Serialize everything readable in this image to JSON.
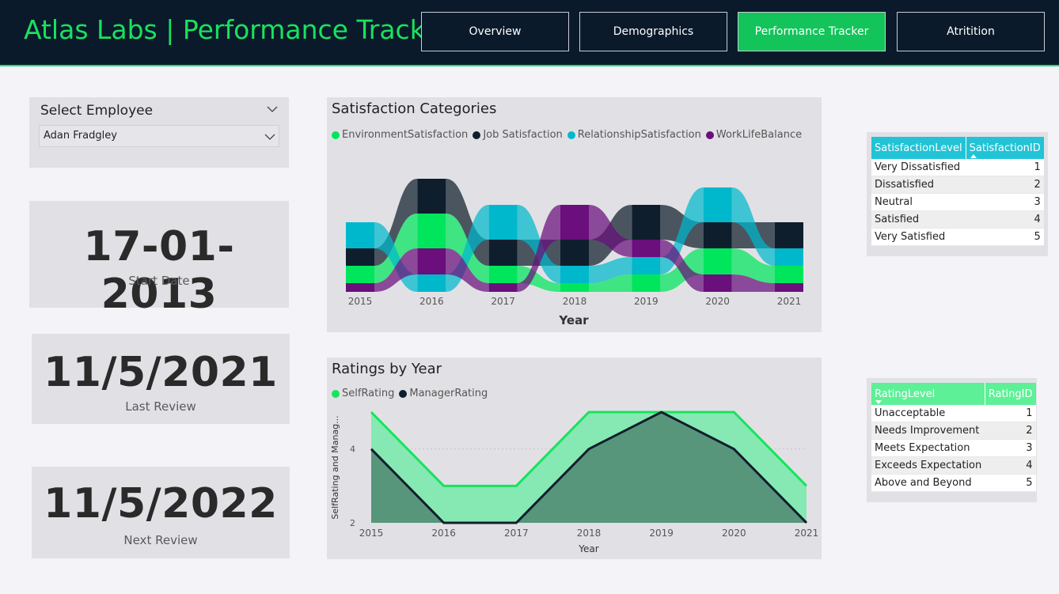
{
  "app": {
    "title": "Atlas Labs | Performance Tracker"
  },
  "nav": [
    {
      "label": "Overview",
      "active": false
    },
    {
      "label": "Demographics",
      "active": false
    },
    {
      "label": "Performance Tracker",
      "active": true
    },
    {
      "label": "Atritition",
      "active": false
    }
  ],
  "slicer": {
    "title": "Select Employee",
    "value": "Adan Fradgley"
  },
  "kpis": {
    "start_date": {
      "value": "17-01-2013",
      "label": "Start Date"
    },
    "last_review": {
      "value": "11/5/2021",
      "label": "Last Review"
    },
    "next_review": {
      "value": "11/5/2022",
      "label": "Next Review"
    }
  },
  "colors": {
    "accent": "#19e25e",
    "header_bg": "#0b1a2b",
    "environment": "#00e65c",
    "job": "#0f1e2d",
    "relationship": "#00b8cc",
    "worklife": "#6a0f7c",
    "table1_header": "#22c3d6",
    "table2_header": "#5ef097"
  },
  "satisfaction_table": {
    "headers": [
      "SatisfactionLevel",
      "SatisfactionID"
    ],
    "sort_icon": "sort-ascending-icon",
    "rows": [
      [
        "Very Dissatisfied",
        "1"
      ],
      [
        "Dissatisfied",
        "2"
      ],
      [
        "Neutral",
        "3"
      ],
      [
        "Satisfied",
        "4"
      ],
      [
        "Very Satisfied",
        "5"
      ]
    ]
  },
  "rating_table": {
    "headers": [
      "RatingLevel",
      "RatingID"
    ],
    "sort_icon": "sort-descending-icon",
    "rows": [
      [
        "Unacceptable",
        "1"
      ],
      [
        "Needs Improvement",
        "2"
      ],
      [
        "Meets Expectation",
        "3"
      ],
      [
        "Exceeds Expectation",
        "4"
      ],
      [
        "Above and Beyond",
        "5"
      ]
    ]
  },
  "chart_data": [
    {
      "type": "ribbon",
      "title": "Satisfaction Categories",
      "xlabel": "Year",
      "categories": [
        "2015",
        "2016",
        "2017",
        "2018",
        "2019",
        "2020",
        "2021"
      ],
      "series": [
        {
          "name": "EnvironmentSatisfaction",
          "color": "#00e65c",
          "values": [
            2,
            4,
            2,
            1,
            2,
            3,
            2
          ]
        },
        {
          "name": "Job Satisfaction",
          "color": "#0f1e2d",
          "values": [
            2,
            4,
            3,
            3,
            4,
            3,
            3
          ]
        },
        {
          "name": "RelationshipSatisfaction",
          "color": "#00b8cc",
          "values": [
            3,
            2,
            4,
            2,
            2,
            4,
            2
          ]
        },
        {
          "name": "WorkLifeBalance",
          "color": "#6a0f7c",
          "values": [
            1,
            3,
            1,
            4,
            2,
            2,
            1
          ]
        }
      ]
    },
    {
      "type": "area",
      "title": "Ratings by Year",
      "xlabel": "Year",
      "ylabel": "SelfRating and Manag...",
      "categories": [
        "2015",
        "2016",
        "2017",
        "2018",
        "2019",
        "2020",
        "2021"
      ],
      "yticks": [
        "2",
        "4"
      ],
      "ylim": [
        2,
        5
      ],
      "series": [
        {
          "name": "SelfRating",
          "color": "#19e25e",
          "values": [
            5,
            3,
            3,
            5,
            5,
            5,
            3
          ]
        },
        {
          "name": "ManagerRating",
          "color": "#0f1e2d",
          "values": [
            4,
            2,
            2,
            4,
            5,
            4,
            2
          ]
        }
      ]
    }
  ]
}
